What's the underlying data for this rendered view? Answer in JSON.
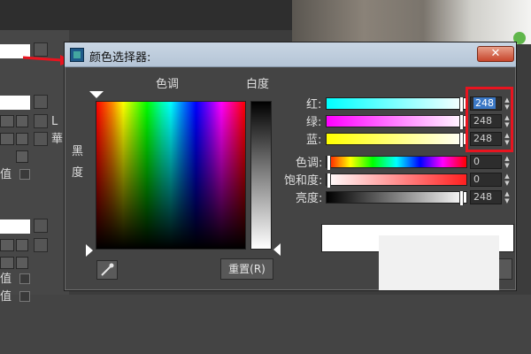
{
  "background": {
    "side_labels": [
      "L",
      "華",
      "值",
      "值",
      "值"
    ]
  },
  "dialog": {
    "title": "颜色选择器:",
    "close_label": "✕",
    "hue_label": "色调",
    "whiteness_label": "白度",
    "blackness_label": "黑度",
    "reset_button": "重置(R)",
    "rows": [
      {
        "label": "红:",
        "value": "248",
        "selected": true
      },
      {
        "label": "绿:",
        "value": "248",
        "selected": false
      },
      {
        "label": "蓝:",
        "value": "248",
        "selected": false
      },
      {
        "label": "色调:",
        "value": "0",
        "selected": false
      },
      {
        "label": "饱和度:",
        "value": "0",
        "selected": false
      },
      {
        "label": "亮度:",
        "value": "248",
        "selected": false
      }
    ]
  },
  "colors": {
    "accent_highlight": "#e8141f",
    "selection": "#3b78c6",
    "current_color": "#f8f8f8"
  },
  "icons": [
    "app-icon",
    "close-icon",
    "eyedropper-icon",
    "arrow-annotation"
  ]
}
